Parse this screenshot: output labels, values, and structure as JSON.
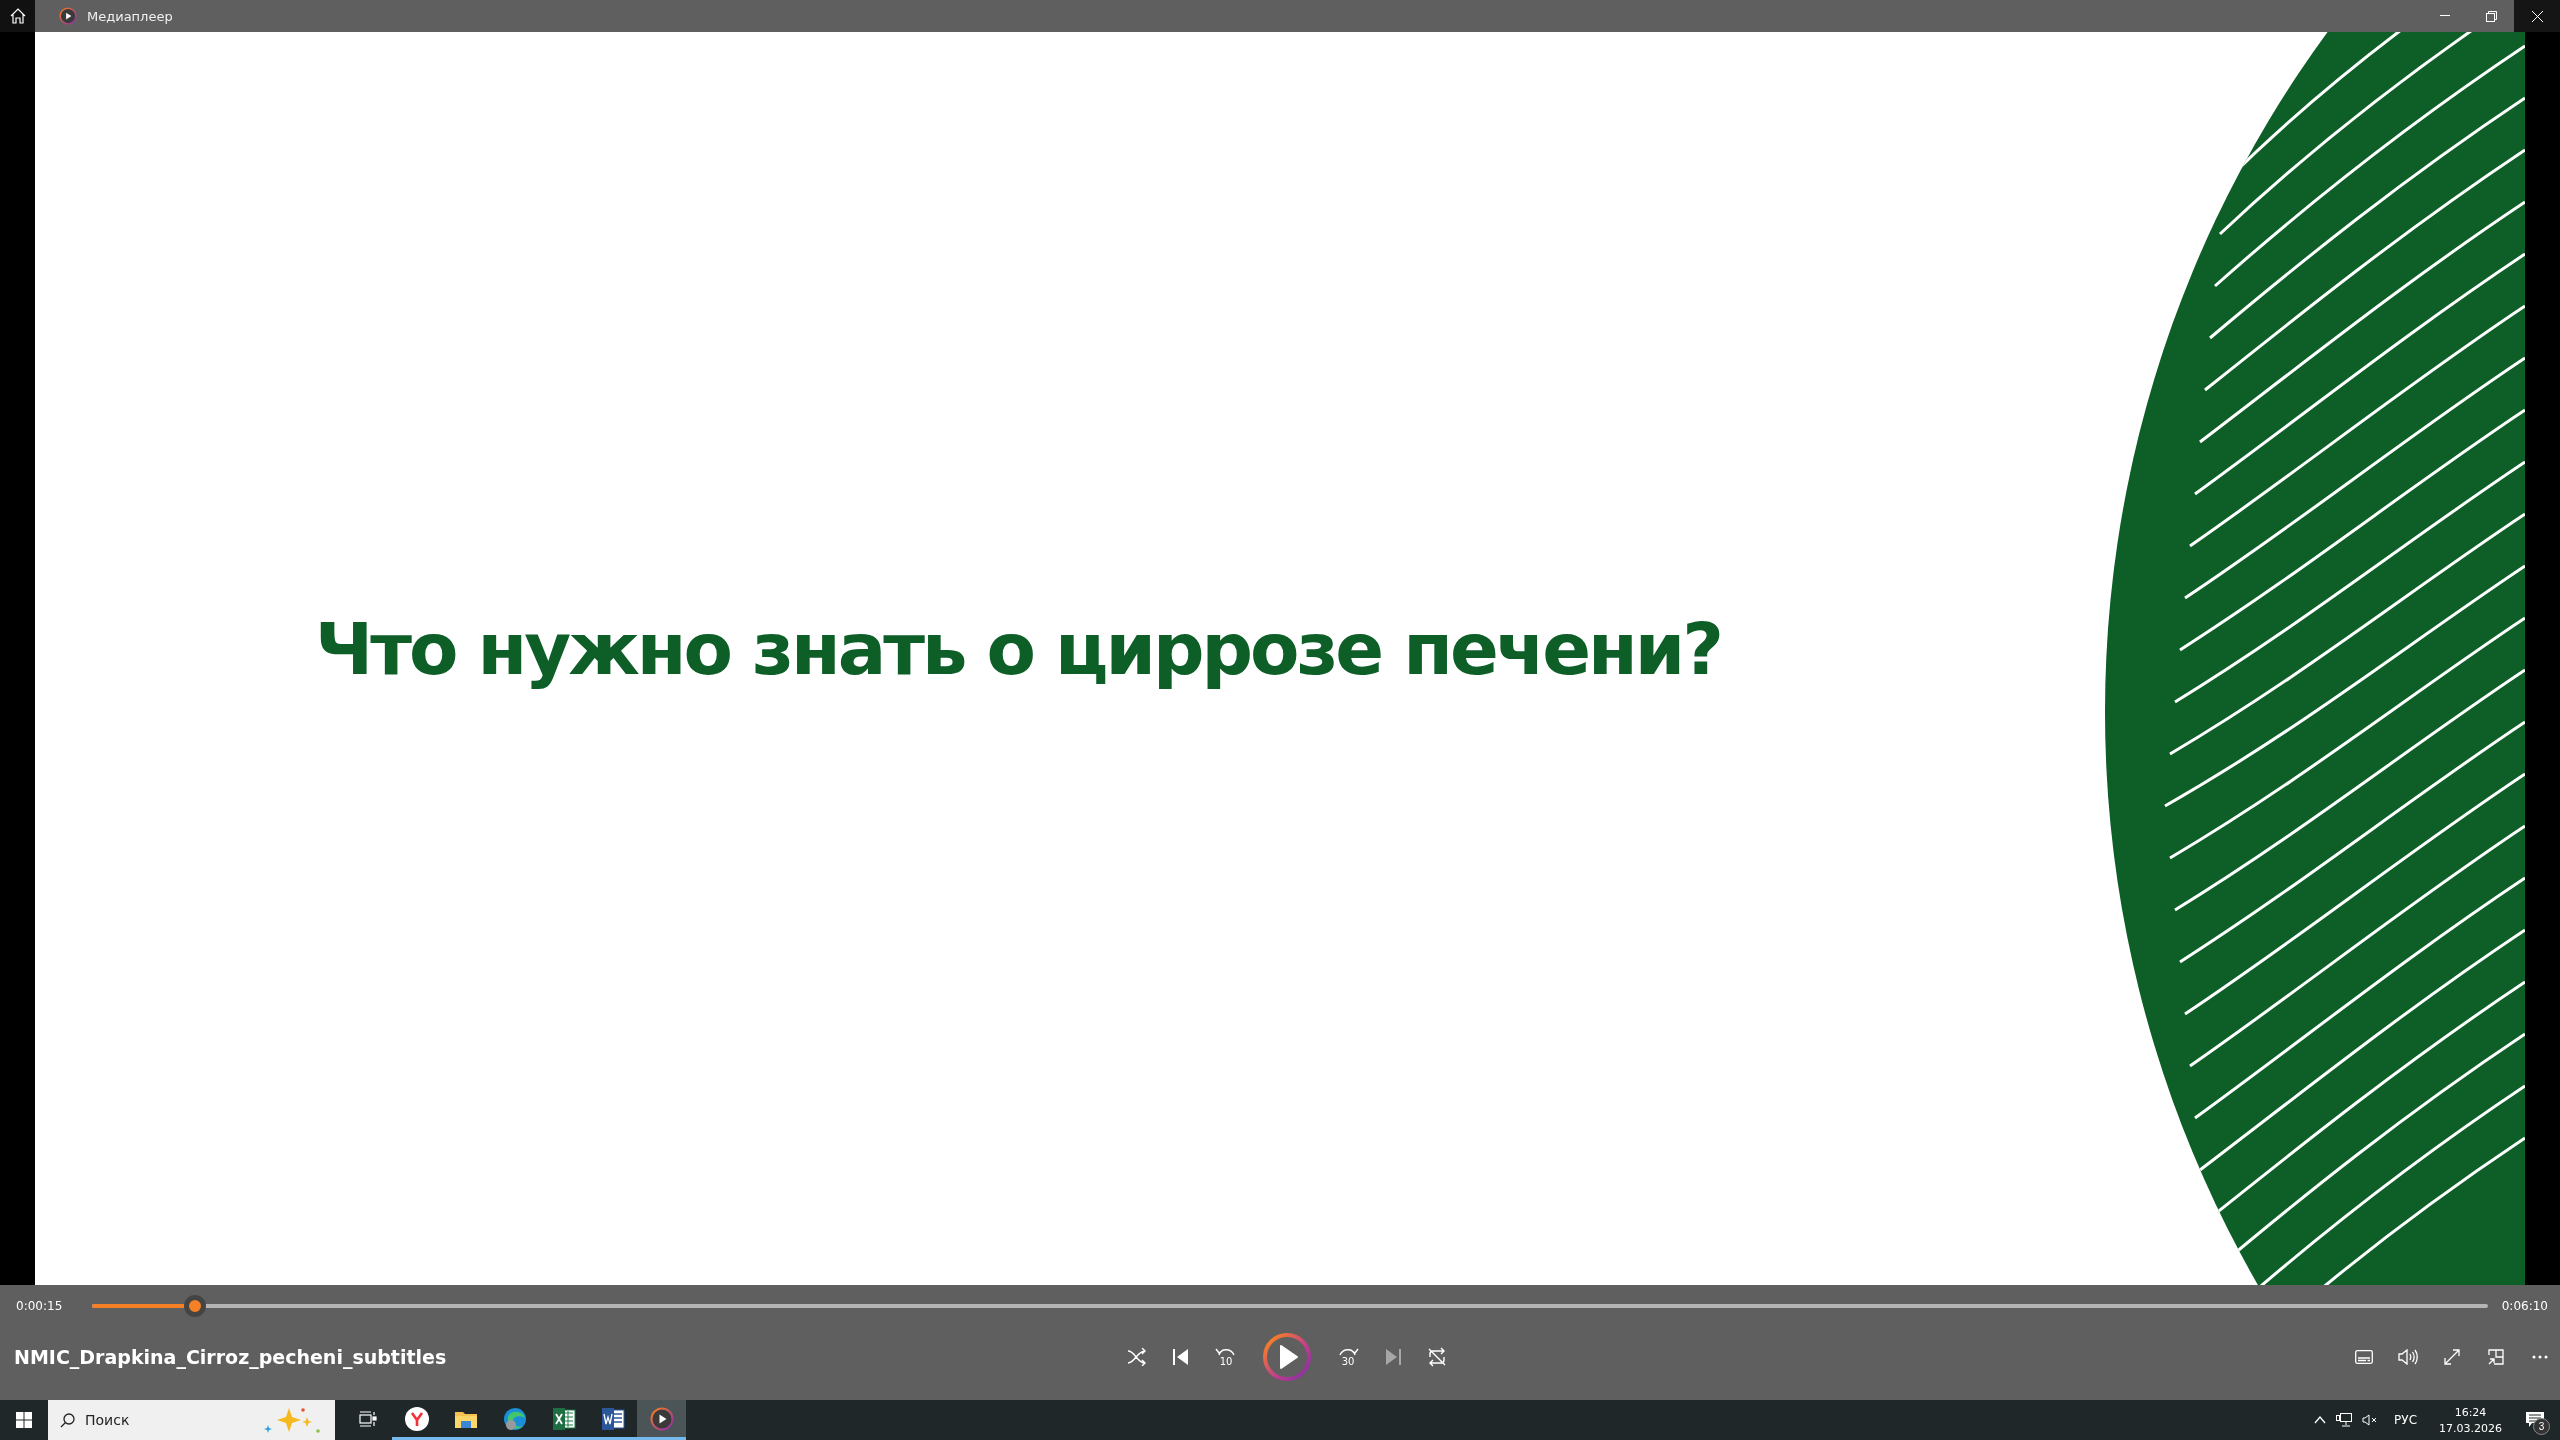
{
  "window": {
    "title": "Медиаплеер"
  },
  "video": {
    "slide_title": "Что нужно знать о циррозе печени?"
  },
  "seek": {
    "elapsed": "0:00:15",
    "total": "0:06:10",
    "level": 0.043
  },
  "media_title": "NMIC_Drapkina_Cirroz_pecheni_subtitles",
  "transport": [
    {
      "kind": "shuffle",
      "disabled": false
    },
    {
      "kind": "previous",
      "disabled": false
    },
    {
      "kind": "rewind",
      "label": "10",
      "disabled": false
    },
    {
      "kind": "play",
      "disabled": false
    },
    {
      "kind": "forward",
      "label": "30",
      "disabled": false
    },
    {
      "kind": "next",
      "disabled": true
    },
    {
      "kind": "repeat",
      "disabled": false
    }
  ],
  "view_controls": [
    {
      "kind": "subtitles"
    },
    {
      "kind": "volume"
    },
    {
      "kind": "fullscreen"
    },
    {
      "kind": "miniplayer"
    },
    {
      "kind": "more"
    }
  ],
  "taskbar": {
    "search": {
      "placeholder": "Поиск"
    },
    "apps": [
      {
        "kind": "taskview",
        "selected": false
      },
      {
        "kind": "yandex",
        "selected": false
      },
      {
        "kind": "explorer",
        "selected": false
      },
      {
        "kind": "edge",
        "selected": false
      },
      {
        "kind": "excel",
        "selected": false
      },
      {
        "kind": "word",
        "selected": false
      },
      {
        "kind": "player",
        "selected": true
      }
    ],
    "tray": {
      "language": "РУС",
      "time": "16:24",
      "date": "17.03.2026",
      "notifications": "3"
    }
  }
}
